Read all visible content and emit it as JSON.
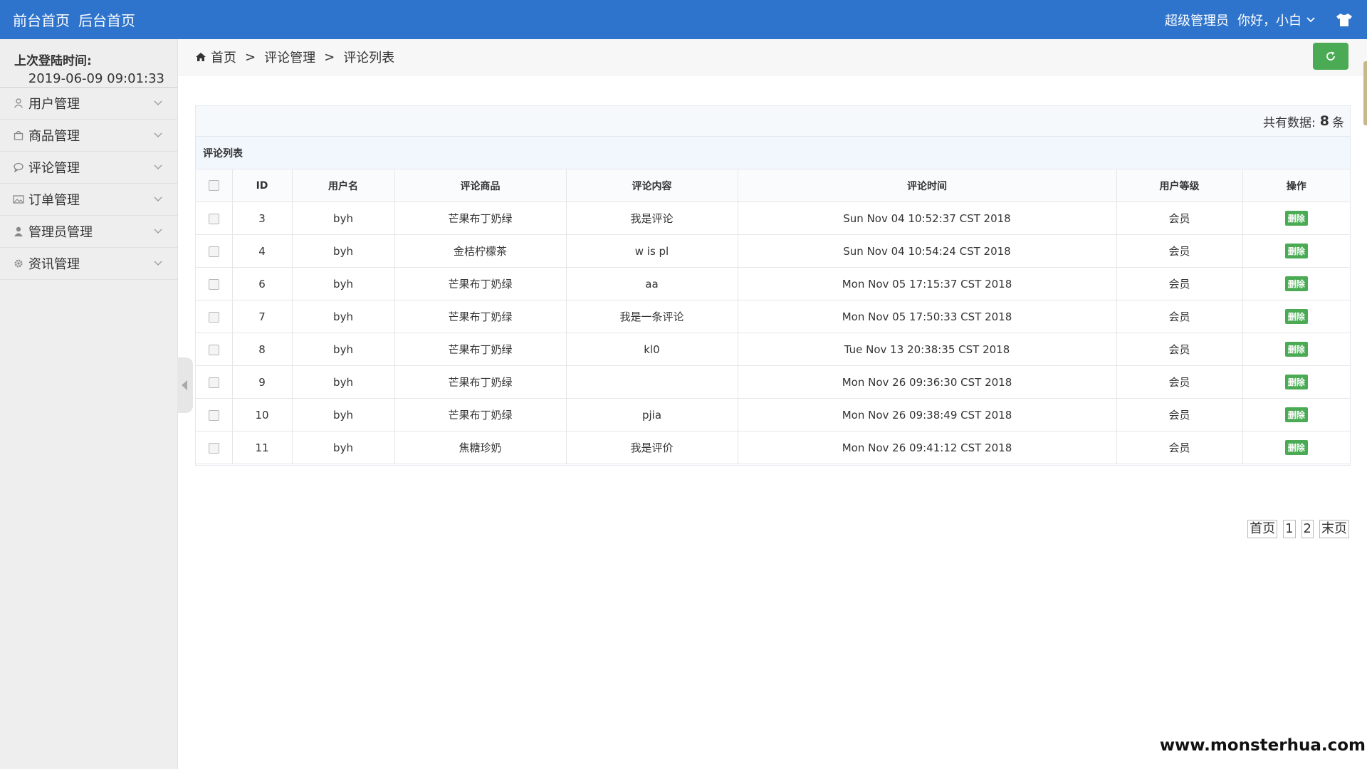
{
  "topbar": {
    "links": [
      "前台首页",
      "后台首页"
    ],
    "role": "超级管理员",
    "greeting": "你好，小白",
    "icons": {
      "chevron": "chevron-down-icon",
      "shirt": "shirt-icon"
    }
  },
  "sidebar": {
    "last_login_label": "上次登陆时间:",
    "last_login_value": "2019-06-09 09:01:33",
    "items": [
      {
        "label": "用户管理",
        "icon": "user-outline-icon"
      },
      {
        "label": "商品管理",
        "icon": "shopping-bag-icon"
      },
      {
        "label": "评论管理",
        "icon": "comment-icon"
      },
      {
        "label": "订单管理",
        "icon": "image-icon"
      },
      {
        "label": "管理员管理",
        "icon": "user-solid-icon"
      },
      {
        "label": "资讯管理",
        "icon": "gear-icon"
      }
    ]
  },
  "breadcrumb": {
    "home": "首页",
    "sep": ">",
    "level1": "评论管理",
    "level2": "评论列表"
  },
  "panel": {
    "count_prefix": "共有数据:",
    "count_value": "8",
    "count_suffix": "条",
    "list_title": "评论列表"
  },
  "table": {
    "headers": [
      "ID",
      "用户名",
      "评论商品",
      "评论内容",
      "评论时间",
      "用户等级",
      "操作"
    ],
    "delete_label": "删除",
    "rows": [
      {
        "id": "3",
        "user": "byh",
        "product": "芒果布丁奶绿",
        "content": "我是评论",
        "time": "Sun Nov 04 10:52:37 CST 2018",
        "level": "会员"
      },
      {
        "id": "4",
        "user": "byh",
        "product": "金桔柠檬茶",
        "content": "w is pl",
        "time": "Sun Nov 04 10:54:24 CST 2018",
        "level": "会员"
      },
      {
        "id": "6",
        "user": "byh",
        "product": "芒果布丁奶绿",
        "content": "aa",
        "time": "Mon Nov 05 17:15:37 CST 2018",
        "level": "会员"
      },
      {
        "id": "7",
        "user": "byh",
        "product": "芒果布丁奶绿",
        "content": "我是一条评论",
        "time": "Mon Nov 05 17:50:33 CST 2018",
        "level": "会员"
      },
      {
        "id": "8",
        "user": "byh",
        "product": "芒果布丁奶绿",
        "content": "kl0",
        "time": "Tue Nov 13 20:38:35 CST 2018",
        "level": "会员"
      },
      {
        "id": "9",
        "user": "byh",
        "product": "芒果布丁奶绿",
        "content": "",
        "time": "Mon Nov 26 09:36:30 CST 2018",
        "level": "会员"
      },
      {
        "id": "10",
        "user": "byh",
        "product": "芒果布丁奶绿",
        "content": "pjia",
        "time": "Mon Nov 26 09:38:49 CST 2018",
        "level": "会员"
      },
      {
        "id": "11",
        "user": "byh",
        "product": "焦糖珍奶",
        "content": "我是评价",
        "time": "Mon Nov 26 09:41:12 CST 2018",
        "level": "会员"
      }
    ]
  },
  "pager": {
    "first": "首页",
    "pages": [
      "1",
      "2"
    ],
    "last": "末页"
  },
  "watermark": "www.monsterhua.com",
  "colors": {
    "topbar": "#2f74cc",
    "action_green": "#4bab55",
    "sidebar_bg": "#eeeeee"
  }
}
